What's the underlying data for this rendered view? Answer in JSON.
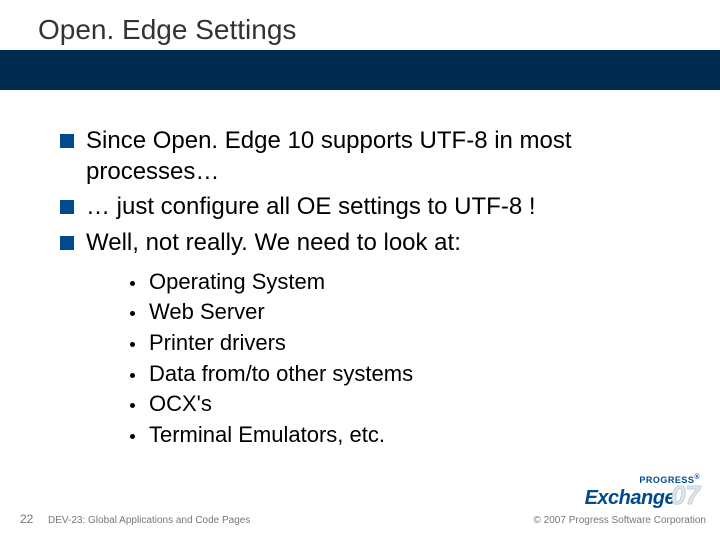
{
  "title": "Open. Edge Settings",
  "bullets": [
    "Since Open. Edge 10 supports UTF-8 in most processes…",
    "… just configure all OE settings to UTF-8 !",
    "Well, not really.  We need to look at:"
  ],
  "subbullets": [
    "Operating System",
    "Web Server",
    "Printer drivers",
    "Data from/to other systems",
    "OCX's",
    "Terminal Emulators, etc."
  ],
  "footer": {
    "slide_number": "22",
    "session": "DEV-23: Global Applications and Code Pages",
    "copyright": "© 2007 Progress Software Corporation"
  },
  "logo": {
    "top": "PROGRESS",
    "reg": "®",
    "main": "Exchange",
    "year": "07"
  }
}
